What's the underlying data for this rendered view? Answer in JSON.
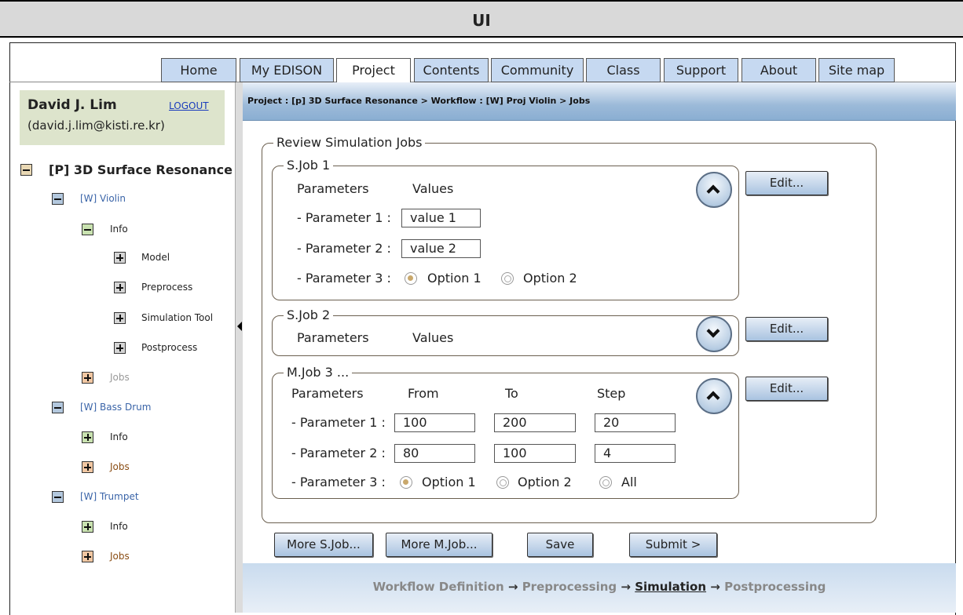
{
  "window": {
    "title": "UI"
  },
  "nav": {
    "tabs": [
      "Home",
      "My EDISON",
      "Project",
      "Contents",
      "Community",
      "Class",
      "Support",
      "About",
      "Site map"
    ],
    "active": "Project"
  },
  "user": {
    "name": "David J. Lim",
    "email": "(david.j.lim@kisti.re.kr)",
    "logout": "LOGOUT"
  },
  "tree": {
    "project": "[P] 3D Surface Resonance",
    "violin": "[W] Violin",
    "violin_info": "Info",
    "model": "Model",
    "preprocess": "Preprocess",
    "simulation_tool": "Simulation Tool",
    "postprocess": "Postprocess",
    "violin_jobs": "Jobs",
    "bass_drum": "[W] Bass Drum",
    "bass_info": "Info",
    "bass_jobs": "Jobs",
    "trumpet": "[W] Trumpet",
    "trumpet_info": "Info",
    "trumpet_jobs": "Jobs"
  },
  "breadcrumb": "Project : [p] 3D Surface Resonance > Workflow : [W] Proj Violin > Jobs",
  "review": {
    "title": "Review Simulation Jobs"
  },
  "sjob1": {
    "title": "S.Job 1",
    "col_params": "Parameters",
    "col_values": "Values",
    "p1_label": "- Parameter 1 :",
    "p1_value": "value 1",
    "p2_label": "- Parameter 2 :",
    "p2_value": "value 2",
    "p3_label": "- Parameter 3 :",
    "opt1": "Option 1",
    "opt2": "Option 2",
    "edit": "Edit..."
  },
  "sjob2": {
    "title": "S.Job 2",
    "col_params": "Parameters",
    "col_values": "Values",
    "edit": "Edit..."
  },
  "mjob3": {
    "title": "M.Job 3 ...",
    "col_params": "Parameters",
    "col_from": "From",
    "col_to": "To",
    "col_step": "Step",
    "p1_label": "- Parameter 1 :",
    "p1_from": "100",
    "p1_to": "200",
    "p1_step": "20",
    "p2_label": "- Parameter 2 :",
    "p2_from": "80",
    "p2_to": "100",
    "p2_step": "4",
    "p3_label": "- Parameter 3 :",
    "opt1": "Option 1",
    "opt2": "Option 2",
    "opt_all": "All",
    "edit": "Edit..."
  },
  "actions": {
    "more_sjob": "More S.Job...",
    "more_mjob": "More M.Job...",
    "save": "Save",
    "submit": "Submit >"
  },
  "workflow": {
    "step1": "Workflow Definition",
    "step2": "Preprocessing",
    "step3": "Simulation",
    "step4": "Postprocessing",
    "arrow": "→"
  }
}
